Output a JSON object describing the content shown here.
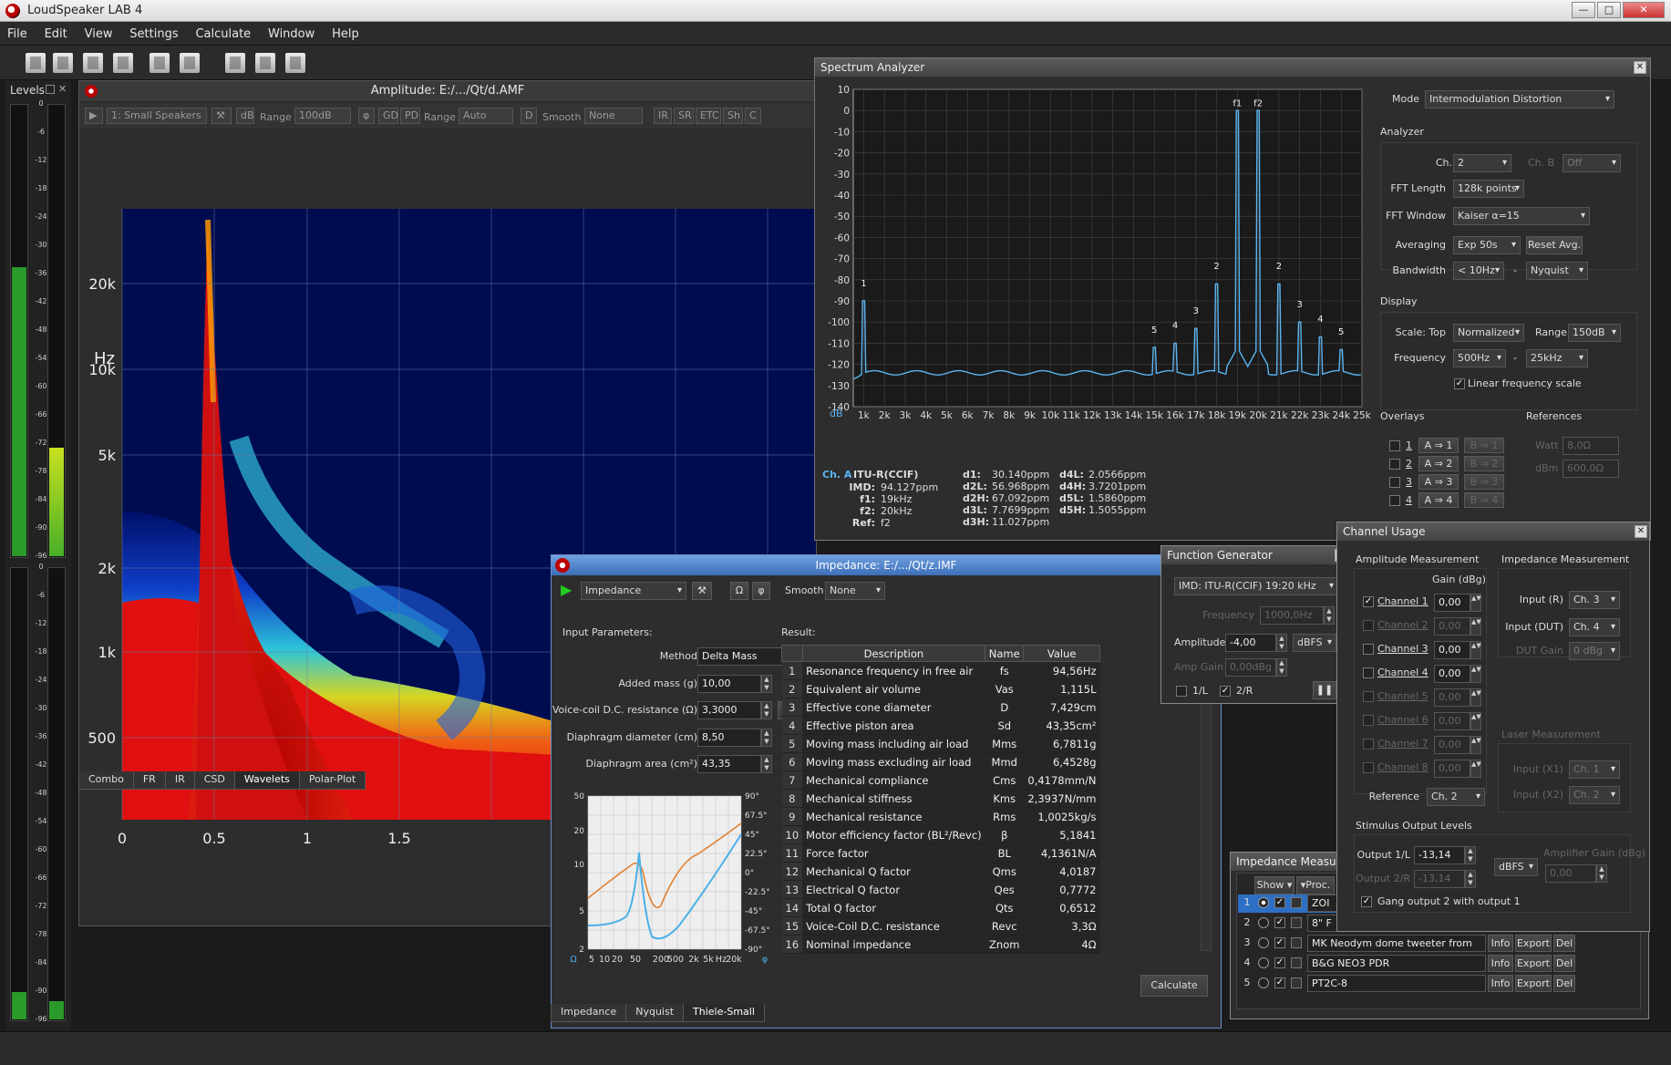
{
  "app": {
    "title": "LoudSpeaker LAB 4",
    "min": "—",
    "max": "□",
    "close": "✕"
  },
  "menu": [
    "File",
    "Edit",
    "View",
    "Settings",
    "Calculate",
    "Window",
    "Help"
  ],
  "icons": [
    "new-icon",
    "open-icon",
    "save-icon",
    "save-all-icon",
    "print-icon",
    "print-preview-icon",
    "cut-icon",
    "copy-icon",
    "paste-icon"
  ],
  "levels": {
    "title": "Levels",
    "scale": [
      "0",
      "-6",
      "-12",
      "-18",
      "-24",
      "-30",
      "-36",
      "-42",
      "-48",
      "-54",
      "-60",
      "-66",
      "-72",
      "-78",
      "-84",
      "-90",
      "-96"
    ],
    "meter1_level": 0.64,
    "meter2_level": 0.24,
    "meter3_level": 0.06,
    "meter4_level": 0.04
  },
  "amplitude": {
    "title": "Amplitude: E:/.../Qt/d.AMF",
    "source": "1: Small Speakers",
    "db": "dB",
    "range_label": "Range",
    "range_value": "100dB",
    "phi": "φ",
    "gd": "GD",
    "pd": "PD",
    "range2_label": "Range",
    "range2_value": "Auto",
    "d": "D",
    "smooth_label": "Smooth",
    "smooth_value": "None",
    "ir": "IR",
    "sr": "SR",
    "etc": "ETC",
    "sh": "Sh",
    "c": "C",
    "y_unit": "Hz",
    "y_ticks": [
      "20k",
      "10k",
      "5k",
      "2k",
      "1k",
      "500"
    ],
    "x_ticks": [
      "0",
      "0.5",
      "1",
      "1.5"
    ],
    "tabs": [
      "Combo",
      "FR",
      "IR",
      "CSD",
      "Wavelets",
      "Polar-Plot"
    ],
    "active_tab": "Wavelets"
  },
  "spectrum": {
    "title": "Spectrum Analyzer",
    "y_ticks": [
      "10",
      "0",
      "-10",
      "-20",
      "-30",
      "-40",
      "-50",
      "-60",
      "-70",
      "-80",
      "-90",
      "-100",
      "-110",
      "-120",
      "-130",
      "-140"
    ],
    "x_unit": "dB",
    "x_ticks": [
      "1k",
      "2k",
      "3k",
      "4k",
      "5k",
      "6k",
      "7k",
      "8k",
      "9k",
      "10k",
      "11k",
      "12k",
      "13k",
      "14k",
      "15k",
      "16k",
      "17k",
      "18k",
      "19k",
      "20k",
      "21k",
      "22k",
      "23k",
      "24k",
      "25k"
    ],
    "peak_labels": [
      "f1",
      "f2",
      "1",
      "2",
      "2",
      "3",
      "3",
      "4",
      "4",
      "5",
      "5"
    ],
    "mode_label": "Mode",
    "mode_value": "Intermodulation Distortion",
    "analyzer_label": "Analyzer",
    "cha_label": "Ch. A",
    "cha_value": "2",
    "chb_label": "Ch. B",
    "chb_value": "Off",
    "fft_length_label": "FFT Length",
    "fft_length_value": "128k points",
    "fft_window_label": "FFT Window",
    "fft_window_value": "Kaiser α=15",
    "averaging_label": "Averaging",
    "averaging_value": "Exp 50s",
    "reset_avg": "Reset Avg.",
    "bandwidth_label": "Bandwidth",
    "bandwidth_value": "< 10Hz",
    "bandwidth_dash": "-",
    "bandwidth_value2": "Nyquist",
    "display_label": "Display",
    "scale_label": "Scale: Top",
    "scale_value": "Normalized",
    "range_label": "Range",
    "range_value": "150dB",
    "frequency_label": "Frequency",
    "freq_from": "500Hz",
    "freq_dash": "-",
    "freq_to": "25kHz",
    "linear_label": "Linear frequency scale",
    "overlays_label": "Overlays",
    "references_label": "References",
    "overlays": [
      {
        "n": "1",
        "a": "A ⇒ 1",
        "b": "B ⇒ 1"
      },
      {
        "n": "2",
        "a": "A ⇒ 2",
        "b": "B ⇒ 2"
      },
      {
        "n": "3",
        "a": "A ⇒ 3",
        "b": "B ⇒ 3"
      },
      {
        "n": "4",
        "a": "A ⇒ 4",
        "b": "B ⇒ 4"
      }
    ],
    "watt_label": "Watt",
    "watt_value": "8,0Ω",
    "dbm_label": "dBm",
    "dbm_value": "600,0Ω",
    "readout": {
      "cha": "Ch. A",
      "std": "ITU-R(CCIF)",
      "rows": [
        {
          "k": "IMD:",
          "v": "94.127ppm"
        },
        {
          "k": "f1:",
          "v": "19kHz"
        },
        {
          "k": "f2:",
          "v": "20kHz"
        },
        {
          "k": "Ref:",
          "v": "f2"
        }
      ],
      "d1": [
        {
          "k": "d1:",
          "v": "30.140ppm"
        },
        {
          "k": "d2L:",
          "v": "56.968ppm"
        },
        {
          "k": "d2H:",
          "v": "67.092ppm"
        },
        {
          "k": "d3L:",
          "v": "7.7699ppm"
        },
        {
          "k": "d3H:",
          "v": "11.027ppm"
        }
      ],
      "d4": [
        {
          "k": "d4L:",
          "v": "2.0566ppm"
        },
        {
          "k": "d4H:",
          "v": "3.7201ppm"
        },
        {
          "k": "d5L:",
          "v": "1.5860ppm"
        },
        {
          "k": "d5H:",
          "v": "1.5055ppm"
        }
      ]
    }
  },
  "impedance": {
    "title": "Impedance: E:/.../Qt/z.IMF",
    "mode": "Impedance",
    "omega": "Ω",
    "phi": "φ",
    "smooth_label": "Smooth",
    "smooth_value": "None",
    "input_params": "Input Parameters:",
    "method_label": "Method",
    "method_value": "Delta Mass",
    "added_mass_label": "Added mass (g)",
    "added_mass_value": "10,00",
    "vc_label": "Voice-coil D.C. resistance (Ω)",
    "vc_value": "3,3000",
    "dd_label": "Diaphragm diameter (cm)",
    "dd_value": "8,50",
    "da_label": "Diaphragm area (cm²)",
    "da_value": "43,35",
    "result_label": "Result:",
    "headers": [
      "Description",
      "Name",
      "Value"
    ],
    "rows": [
      [
        "1",
        "Resonance frequency in free air",
        "fs",
        "94,56Hz"
      ],
      [
        "2",
        "Equivalent air volume",
        "Vas",
        "1,115L"
      ],
      [
        "3",
        "Effective cone diameter",
        "D",
        "7,429cm"
      ],
      [
        "4",
        "Effective piston area",
        "Sd",
        "43,35cm²"
      ],
      [
        "5",
        "Moving mass including air load",
        "Mms",
        "6,7811g"
      ],
      [
        "6",
        "Moving mass excluding air load",
        "Mmd",
        "6,4528g"
      ],
      [
        "7",
        "Mechanical compliance",
        "Cms",
        "0,4178mm/N"
      ],
      [
        "8",
        "Mechanical stiffness",
        "Kms",
        "2,3937N/mm"
      ],
      [
        "9",
        "Mechanical resistance",
        "Rms",
        "1,0025kg/s"
      ],
      [
        "10",
        "Motor efficiency factor (BL²/Revc)",
        "β",
        "5,1841"
      ],
      [
        "11",
        "Force factor",
        "BL",
        "4,1361N/A"
      ],
      [
        "12",
        "Mechanical Q factor",
        "Qms",
        "4,0187"
      ],
      [
        "13",
        "Electrical Q factor",
        "Qes",
        "0,7772"
      ],
      [
        "14",
        "Total Q factor",
        "Qts",
        "0,6512"
      ],
      [
        "15",
        "Voice-Coil D.C. resistance",
        "Revc",
        "3,3Ω"
      ],
      [
        "16",
        "Nominal impedance",
        "Znom",
        "4Ω"
      ]
    ],
    "calculate": "Calculate",
    "mini_y_left": [
      "50",
      "20",
      "10",
      "5",
      "2"
    ],
    "mini_y_right": [
      "90°",
      "67.5°",
      "45°",
      "22.5°",
      "0°",
      "-22.5°",
      "-45°",
      "-67.5°",
      "-90°"
    ],
    "mini_x": [
      "Ω",
      "5",
      "10",
      "20",
      "50",
      "200",
      "500",
      "2k",
      "5k",
      "Hz",
      "20k",
      "φ"
    ],
    "tabs": [
      "Impedance",
      "Nyquist",
      "Thiele-Small"
    ],
    "active_tab": "Thiele-Small"
  },
  "function_generator": {
    "title": "Function Generator",
    "signal": "IMD: ITU-R(CCIF) 19:20 kHz",
    "frequency_label": "Frequency",
    "frequency_value": "1000,0Hz",
    "amplitude_label": "Amplitude",
    "amplitude_value": "-4,00",
    "amplitude_unit": "dBFS",
    "amp_gain_label": "Amp Gain",
    "amp_gain_value": "0,00dBg",
    "l_label": "1/L",
    "r_label": "2/R",
    "pause": "❚❚"
  },
  "channel_usage": {
    "title": "Channel Usage",
    "amp_meas": "Amplitude Measurement",
    "imp_meas": "Impedance Measurement",
    "gain_label": "Gain (dBg)",
    "channels": [
      {
        "name": "Channel 1",
        "gain": "0,00",
        "checked": true,
        "enabled": true
      },
      {
        "name": "Channel 2",
        "gain": "0,00",
        "checked": false,
        "enabled": false
      },
      {
        "name": "Channel 3",
        "gain": "0,00",
        "checked": false,
        "enabled": true
      },
      {
        "name": "Channel 4",
        "gain": "0,00",
        "checked": false,
        "enabled": true
      },
      {
        "name": "Channel 5",
        "gain": "0,00",
        "checked": false,
        "enabled": false
      },
      {
        "name": "Channel 6",
        "gain": "0,00",
        "checked": false,
        "enabled": false
      },
      {
        "name": "Channel 7",
        "gain": "0,00",
        "checked": false,
        "enabled": false
      },
      {
        "name": "Channel 8",
        "gain": "0,00",
        "checked": false,
        "enabled": false
      }
    ],
    "input_r_label": "Input (R)",
    "input_r_value": "Ch. 3",
    "input_dut_label": "Input (DUT)",
    "input_dut_value": "Ch. 4",
    "dut_gain_label": "DUT Gain",
    "dut_gain_value": "0 dBg",
    "laser_label": "Laser Measurement",
    "input_x1_label": "Input (X1)",
    "input_x1_value": "Ch. 1",
    "input_x2_label": "Input (X2)",
    "input_x2_value": "Ch. 2",
    "reference_label": "Reference",
    "reference_value": "Ch. 2",
    "stimulus_label": "Stimulus Output Levels",
    "out1_label": "Output 1/L",
    "out1_value": "-13,14",
    "out2_label": "Output 2/R",
    "out2_value": "-13,14",
    "out_unit": "dBFS",
    "amp_gain_label": "Amplifier Gain (dBg)",
    "amp_gain_value": "0,00",
    "gang_label": "Gang output 2 with output 1"
  },
  "impedance_measurements": {
    "title": "Impedance Measure",
    "show": "Show ▾",
    "proc": "▾Proc.",
    "rows": [
      {
        "n": "1",
        "name": "ZOI",
        "selected": true
      },
      {
        "n": "2",
        "name": "8\" F",
        "selected": false
      },
      {
        "n": "3",
        "name": "MK Neodym dome tweeter from eBay",
        "selected": false
      },
      {
        "n": "4",
        "name": "B&G NEO3 PDR",
        "selected": false
      },
      {
        "n": "5",
        "name": "PT2C-8",
        "selected": false
      }
    ],
    "info": "Info",
    "export": "Export",
    "del": "Del"
  },
  "colors": {
    "accent": "#4aa3e8",
    "spectrum_line": "#5ab4f0",
    "title_active": "#3d6fb8",
    "orange_curve": "#e08030",
    "blue_curve": "#4ab0e8"
  }
}
